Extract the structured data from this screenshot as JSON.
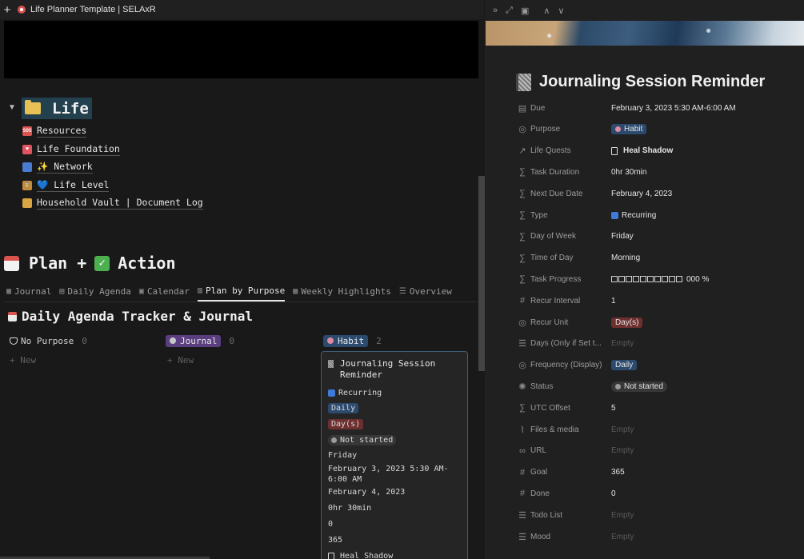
{
  "window": {
    "new_tab_glyph": "+",
    "title": "Life Planner Template | SELAxR"
  },
  "life": {
    "title": "Life",
    "links": [
      {
        "label": "Resources",
        "icon": "sos-icon",
        "icon_text": "SOS",
        "color": "#d9534f"
      },
      {
        "label": "Life Foundation",
        "icon": "heart-icon",
        "icon_text": "♥",
        "color": "#e0535f"
      },
      {
        "label": "✨ Network",
        "icon": "people-icon",
        "icon_text": "",
        "color": "#4a7bd0"
      },
      {
        "label": "💙 Life Level",
        "icon": "hourglass-icon",
        "icon_text": "⌛",
        "color": "#c58b3c"
      },
      {
        "label": "Household Vault | Document Log",
        "icon": "scroll-icon",
        "icon_text": "",
        "color": "#d9a441"
      }
    ]
  },
  "plan": {
    "title_left": "Plan +",
    "title_right": "Action",
    "tabs": [
      {
        "label": "Journal",
        "icon": "table-icon",
        "glyph": "▦",
        "active": false
      },
      {
        "label": "Daily Agenda",
        "icon": "list-icon",
        "glyph": "▤",
        "active": false
      },
      {
        "label": "Calendar",
        "icon": "calendar-icon",
        "glyph": "▣",
        "active": false
      },
      {
        "label": "Plan by Purpose",
        "icon": "board-icon",
        "glyph": "▥",
        "active": true
      },
      {
        "label": "Weekly Highlights",
        "icon": "gallery-icon",
        "glyph": "▦",
        "active": false
      },
      {
        "label": "Overview",
        "icon": "list-icon",
        "glyph": "☰",
        "active": false
      }
    ]
  },
  "board": {
    "title": "Daily Agenda Tracker & Journal",
    "new_label": "+ New",
    "columns": [
      {
        "label": "No Purpose",
        "count": "0"
      },
      {
        "label": "Journal",
        "count": "0",
        "color": "#5a3e80"
      },
      {
        "label": "Habit",
        "count": "2",
        "color": "#2b4a6e"
      }
    ],
    "card": {
      "title": "Journaling Session Reminder",
      "type": "Recurring",
      "frequency": "Daily",
      "recur_unit": "Day(s)",
      "status": "Not started",
      "day": "Friday",
      "due": "February 3, 2023 5:30 AM-6:00 AM",
      "next_due": "February 4, 2023",
      "duration": "0hr 30min",
      "done": "0",
      "goal": "365",
      "quest": "Heal Shadow"
    }
  },
  "panel": {
    "toolbar": {
      "collapse": "»",
      "expand": "⤢",
      "sidepeek": "▣",
      "up": "∧",
      "down": "∨"
    },
    "title": "Journaling Session Reminder",
    "properties": [
      {
        "icon": "calendar-icon",
        "glyph": "▤",
        "label": "Due",
        "value": "February 3, 2023 5:30 AM-6:00 AM"
      },
      {
        "icon": "select-icon",
        "glyph": "◎",
        "label": "Purpose",
        "value": "Habit",
        "pill": "#2b4a6e",
        "dot": "#e08aa0"
      },
      {
        "icon": "relation-icon",
        "glyph": "↗",
        "label": "Life Quests",
        "value": "Heal Shadow",
        "doc": true,
        "bold": true
      },
      {
        "icon": "formula-icon",
        "glyph": "∑",
        "label": "Task Duration",
        "value": "0hr 30min"
      },
      {
        "icon": "formula-icon",
        "glyph": "∑",
        "label": "Next Due Date",
        "value": "February 4, 2023"
      },
      {
        "icon": "formula-icon",
        "glyph": "∑",
        "label": "Type",
        "value": "Recurring",
        "rec": true
      },
      {
        "icon": "formula-icon",
        "glyph": "∑",
        "label": "Day of Week",
        "value": "Friday"
      },
      {
        "icon": "formula-icon",
        "glyph": "∑",
        "label": "Time of Day",
        "value": "Morning"
      },
      {
        "icon": "formula-icon",
        "glyph": "∑",
        "label": "Task Progress",
        "value": "000 %",
        "bar": 10
      },
      {
        "icon": "number-icon",
        "glyph": "#",
        "label": "Recur Interval",
        "value": "1"
      },
      {
        "icon": "select-icon",
        "glyph": "◎",
        "label": "Recur Unit",
        "value": "Day(s)",
        "pill": "#6e2f2f"
      },
      {
        "icon": "multiselect-icon",
        "glyph": "☰",
        "label": "Days (Only if Set t...",
        "value": "Empty",
        "empty": true
      },
      {
        "icon": "select-icon",
        "glyph": "◎",
        "label": "Frequency (Display)",
        "value": "Daily",
        "pill": "#2b4a6e"
      },
      {
        "icon": "status-icon",
        "glyph": "✺",
        "label": "Status",
        "value": "Not started",
        "pill": "#373737",
        "round": true,
        "sdot": true
      },
      {
        "icon": "formula-icon",
        "glyph": "∑",
        "label": "UTC Offset",
        "value": "5"
      },
      {
        "icon": "paperclip-icon",
        "glyph": "⌇",
        "label": "Files & media",
        "value": "Empty",
        "empty": true
      },
      {
        "icon": "link-icon",
        "glyph": "∞",
        "label": "URL",
        "value": "Empty",
        "empty": true
      },
      {
        "icon": "number-icon",
        "glyph": "#",
        "label": "Goal",
        "value": "365"
      },
      {
        "icon": "number-icon",
        "glyph": "#",
        "label": "Done",
        "value": "0"
      },
      {
        "icon": "multiselect-icon",
        "glyph": "☰",
        "label": "Todo List",
        "value": "Empty",
        "empty": true
      },
      {
        "icon": "multiselect-icon",
        "glyph": "☰",
        "label": "Mood",
        "value": "Empty",
        "empty": true
      }
    ]
  }
}
